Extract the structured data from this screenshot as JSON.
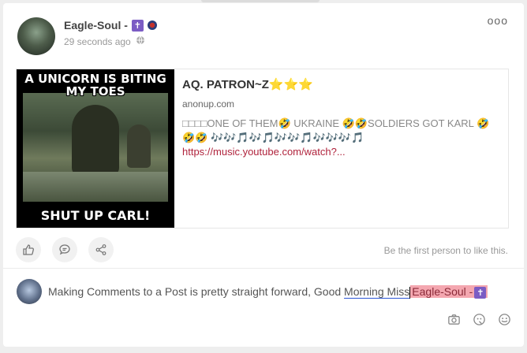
{
  "post": {
    "author": "Eagle-Soul -",
    "author_badge": "✝",
    "timestamp": "29 seconds ago",
    "more_label": "ooo",
    "privacy_icon": "globe-icon"
  },
  "link_preview": {
    "image_text_top": "A UNICORN IS BITING MY TOES",
    "image_text_bottom": "SHUT UP CARL!",
    "title": "AQ. PATRON~Z",
    "title_stars": "⭐⭐⭐",
    "domain": "anonup.com",
    "description": "□□□□ONE OF THEM🤣 UKRAINE 🤣🤣SOLDIERS GOT KARL 🤣🤣🤣 🎶🎶🎵🎶🎵🎶🎶🎵🎶🎶🎶🎵",
    "url": "https://music.youtube.com/watch?..."
  },
  "actions": {
    "like_icon": "thumbs-up-icon",
    "comment_icon": "comment-icon",
    "share_icon": "share-icon",
    "likes_text": "Be the first person to like this."
  },
  "comment": {
    "text_before": "Making Comments to a Post is pretty straight forward, Good ",
    "misspelled": "Morning Miss",
    "mention": "Eagle-Soul -",
    "mention_badge": "✝",
    "tools": [
      "camera-icon",
      "gif-icon",
      "emoji-icon"
    ]
  },
  "colors": {
    "link": "#b0233c",
    "mention_bg": "#f4a7b0",
    "badge": "#7b5cc4"
  }
}
